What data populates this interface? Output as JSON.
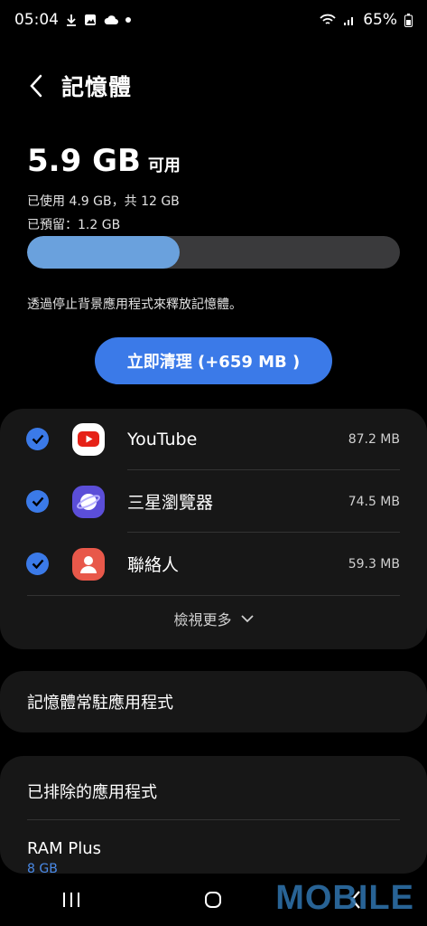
{
  "status": {
    "time": "05:04",
    "battery": "65%"
  },
  "header": {
    "title": "記憶體"
  },
  "summary": {
    "available_value": "5.9 GB",
    "available_unit": "可用",
    "used_text": "已使用 4.9 GB，共 12 GB",
    "reserved_text": "已預留：1.2 GB",
    "usage_fraction": 0.41
  },
  "hint": "透過停止背景應用程式來釋放記憶體。",
  "clean_button": "立即清理 (+659 MB )",
  "apps": [
    {
      "name": "YouTube",
      "size": "87.2 MB",
      "checked": true,
      "icon": "youtube-icon",
      "color": "#e62117"
    },
    {
      "name": "三星瀏覽器",
      "size": "74.5 MB",
      "checked": true,
      "icon": "samsung-internet-icon",
      "color": "#5b4ed8"
    },
    {
      "name": "聯絡人",
      "size": "59.3 MB",
      "checked": true,
      "icon": "contacts-icon",
      "color": "#e8584a"
    }
  ],
  "view_more": "檢視更多",
  "resident_apps": "記憶體常駐應用程式",
  "excluded_apps": "已排除的應用程式",
  "ram_plus": {
    "label": "RAM Plus",
    "value": "8 GB"
  },
  "watermark": "MOBILE"
}
